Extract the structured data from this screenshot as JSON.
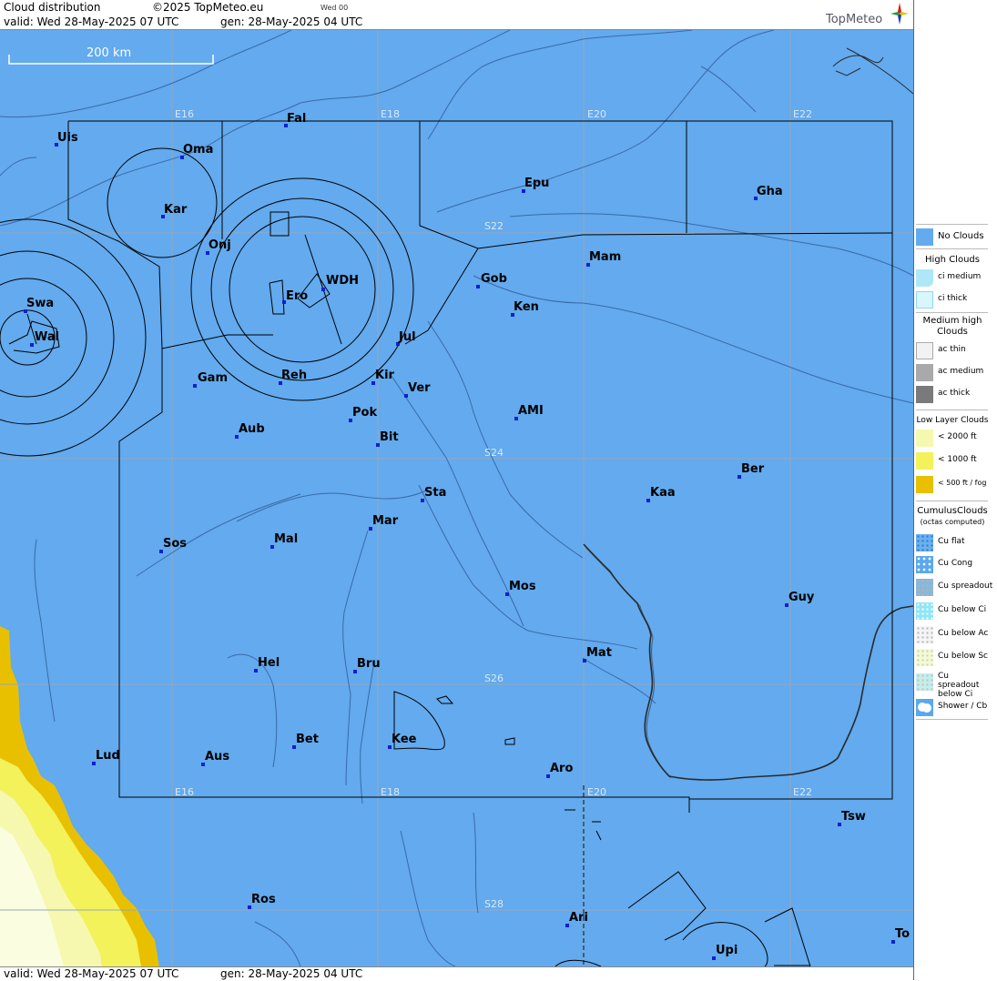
{
  "header": {
    "title": "Cloud distribution",
    "copyright": "©2025 TopMeteo.eu",
    "day_code": "Wed 00",
    "valid": "valid:  Wed  28-May-2025  07 UTC",
    "gen": "gen: 28-May-2025 04 UTC",
    "logo": "TopMeteo"
  },
  "scale_bar": "200 km",
  "footer": {
    "valid": "valid:  Wed  28-May-2025  07 UTC",
    "gen": "gen: 28-May-2025 04 UTC"
  },
  "grid_labels": {
    "top": [
      "E16",
      "E18",
      "E20",
      "E22"
    ],
    "bottom": [
      "E16",
      "E18",
      "E20",
      "E22"
    ],
    "lat": [
      "S22",
      "S24",
      "S26",
      "S28"
    ]
  },
  "stations": [
    {
      "name": "Uis"
    },
    {
      "name": "Fal"
    },
    {
      "name": "Oma"
    },
    {
      "name": "Kar"
    },
    {
      "name": "Epu"
    },
    {
      "name": "Gha"
    },
    {
      "name": "Onj"
    },
    {
      "name": "Mam"
    },
    {
      "name": "Swa"
    },
    {
      "name": "Gob"
    },
    {
      "name": "WDH"
    },
    {
      "name": "Ero"
    },
    {
      "name": "Ken"
    },
    {
      "name": "Wal"
    },
    {
      "name": "Jul"
    },
    {
      "name": "Gam"
    },
    {
      "name": "Reh"
    },
    {
      "name": "Kir"
    },
    {
      "name": "Ver"
    },
    {
      "name": "AMI"
    },
    {
      "name": "Pok"
    },
    {
      "name": "Aub"
    },
    {
      "name": "Bit"
    },
    {
      "name": "Ber"
    },
    {
      "name": "Sta"
    },
    {
      "name": "Kaa"
    },
    {
      "name": "Mar"
    },
    {
      "name": "Sos"
    },
    {
      "name": "Mal"
    },
    {
      "name": "Mos"
    },
    {
      "name": "Guy"
    },
    {
      "name": "Mat"
    },
    {
      "name": "Hel"
    },
    {
      "name": "Bru"
    },
    {
      "name": "Bet"
    },
    {
      "name": "Kee"
    },
    {
      "name": "Lud"
    },
    {
      "name": "Aus"
    },
    {
      "name": "Aro"
    },
    {
      "name": "Tsw"
    },
    {
      "name": "Ros"
    },
    {
      "name": "Ari"
    },
    {
      "name": "To"
    },
    {
      "name": "Upi"
    }
  ],
  "legend": {
    "no_clouds": "No Clouds",
    "high_head": "High Clouds",
    "ci_medium": "ci medium",
    "ci_thick": "ci thick",
    "medium_head": "Medium high Clouds",
    "ac_thin": "ac thin",
    "ac_medium": "ac medium",
    "ac_thick": "ac thick",
    "low_head": "Low Layer Clouds",
    "lt2000": "< 2000 ft",
    "lt1000": "< 1000 ft",
    "lt500": "< 500 ft / fog",
    "cu_head": "CumulusClouds",
    "cu_sub": "(octas computed)",
    "cu_flat": "Cu flat",
    "cu_cong": "Cu Cong",
    "cu_spread": "Cu spreadout",
    "cu_below_ci": "Cu below Ci",
    "cu_below_ac": "Cu below Ac",
    "cu_below_sc": "Cu below Sc",
    "cu_spread_ci": "Cu spreadout below Ci",
    "shower": "Shower / Cb",
    "colors": {
      "no_clouds": "#63aaee",
      "ci_medium": "#aee8f8",
      "ci_thick": "#d8f6fb",
      "ac_thin": "#f2f2f2",
      "ac_medium": "#a9a9a9",
      "ac_thick": "#7a7a7a",
      "lt2000": "#f6f8b0",
      "lt1000": "#f3f25a",
      "lt500": "#e8c000"
    }
  }
}
